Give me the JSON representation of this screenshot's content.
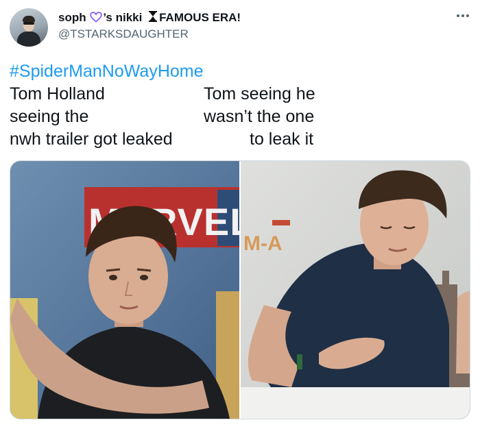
{
  "author": {
    "name_part1": "soph",
    "name_part2": "’s nikki",
    "name_part3": "FAMOUS ERA!",
    "handle": "@TSTARKSDAUGHTER"
  },
  "tweet": {
    "hashtag": "#SpiderManNoWayHome",
    "left_caption": [
      "Tom Holland",
      "seeing the",
      "nwh trailer got leaked"
    ],
    "right_caption": [
      "Tom seeing he",
      "wasn’t the one",
      "to leak it"
    ]
  },
  "media": {
    "left_backdrop_text": "MARVEL S",
    "right_backdrop_text": "M-A"
  },
  "colors": {
    "link": "#1d9bf0",
    "secondary_text": "#536471",
    "heart": "#8a5cf6"
  },
  "icons": {
    "more": "more-horizontal-icon",
    "heart": "purple-heart-outline-icon",
    "hourglass": "hourglass-icon"
  }
}
